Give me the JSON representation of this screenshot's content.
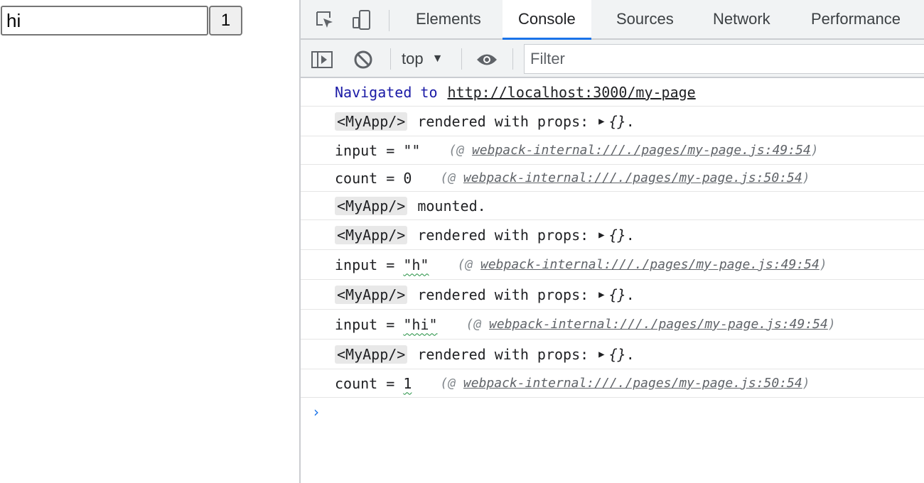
{
  "page": {
    "input_value": "hi",
    "button_label": "1"
  },
  "devtools": {
    "tabs": [
      "Elements",
      "Console",
      "Sources",
      "Network",
      "Performance"
    ],
    "active_tab": "Console",
    "toolbar": {
      "context": "top",
      "filter_placeholder": "Filter"
    },
    "console": {
      "navigated_prefix": "Navigated to",
      "navigated_url": "http://localhost:3000/my-page",
      "rendered_tag": "<MyApp/>",
      "rendered_text": "rendered with props:",
      "obj": "{}",
      "dot": ".",
      "mounted_text": "mounted.",
      "source_open": "(@ ",
      "source_close": ")",
      "src_49": "webpack-internal:///./pages/my-page.js:49:54",
      "src_50": "webpack-internal:///./pages/my-page.js:50:54",
      "line_input_empty": "input = \"\"",
      "line_count_0": "count = 0",
      "input_prefix": "input = ",
      "input_h": "\"h\"",
      "input_hi": "\"hi\"",
      "count_prefix": "count = ",
      "count_1": "1"
    }
  }
}
